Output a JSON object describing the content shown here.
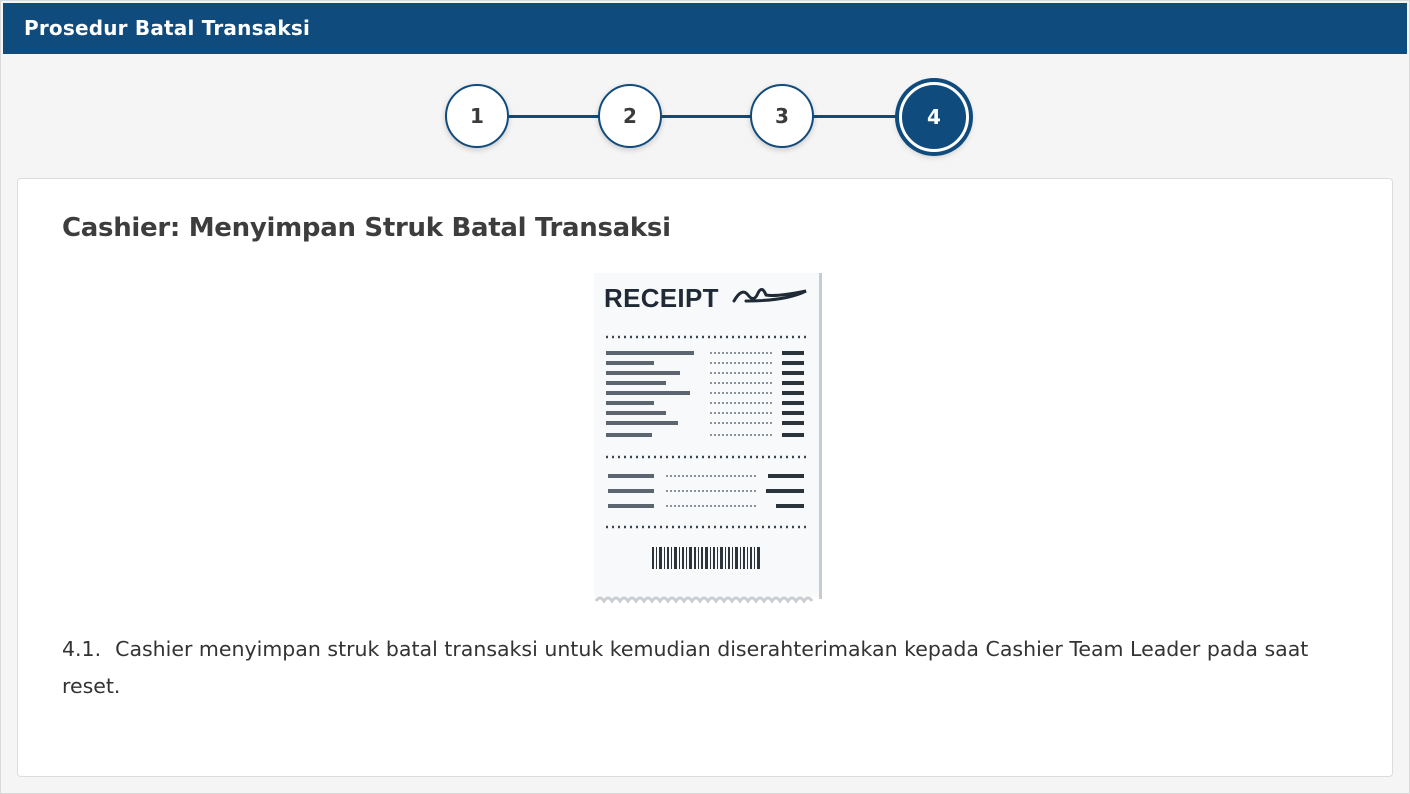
{
  "window": {
    "title": "Prosedur Batal Transaksi"
  },
  "stepper": {
    "steps": [
      "1",
      "2",
      "3",
      "4"
    ],
    "active_step": "4"
  },
  "content": {
    "heading": "Cashier: Menyimpan Struk Batal Transaksi",
    "image": {
      "receipt_title": "RECEIPT"
    },
    "item_number": "4.1.",
    "item_text": "Cashier menyimpan struk batal transaksi untuk kemudian diserahterimakan kepada Cashier Team Leader pada saat reset."
  },
  "colors": {
    "primary": "#104b7d",
    "background": "#f5f5f5",
    "card": "#ffffff",
    "text": "#333333"
  }
}
